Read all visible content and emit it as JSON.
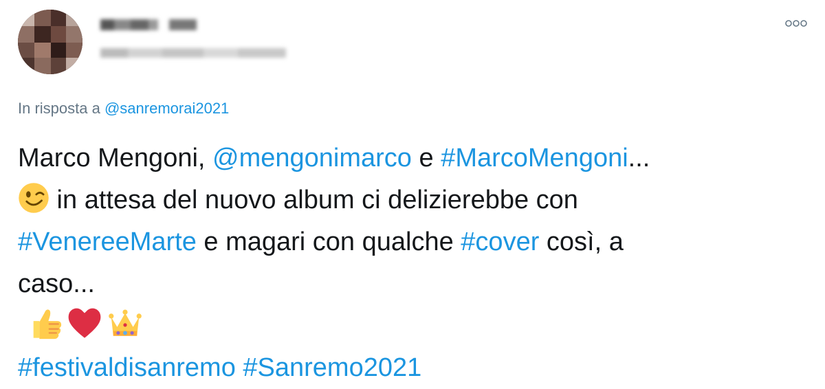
{
  "reply_context": {
    "prefix": "In risposta a",
    "handle": "@sanremorai2021"
  },
  "tweet": {
    "line1": {
      "t1": "Marco Mengoni, ",
      "mention": "@mengonimarco",
      "t2": " e ",
      "hashtag": "#MarcoMengoni",
      "t3": "..."
    },
    "line2": {
      "text": " in attesa del nuovo album ci delizierebbe con"
    },
    "line3": {
      "hashtag1": "#VenereeMarte",
      "t1": " e magari con qualche ",
      "hashtag2": "#cover",
      "t2": " così, a"
    },
    "line4": {
      "text": "caso..."
    },
    "line6": {
      "hashtag1": "#festivaldisanremo",
      "space": " ",
      "hashtag2": "#Sanremo2021"
    }
  },
  "icons": {
    "more": "more-icon",
    "wink": "winking-face-emoji",
    "thumbs": "thumbs-up-emoji",
    "heart": "red-heart-emoji",
    "crown": "crown-emoji"
  },
  "colors": {
    "link": "#1b95e0",
    "text": "#14171a",
    "secondary": "#657786"
  }
}
